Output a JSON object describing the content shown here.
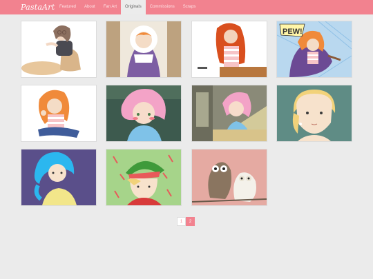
{
  "brand": "PastaArt",
  "nav": {
    "items": [
      {
        "label": "Featured"
      },
      {
        "label": "About"
      },
      {
        "label": "Fan Art"
      },
      {
        "label": "Originals",
        "active": true
      },
      {
        "label": "Commissions"
      },
      {
        "label": "Scraps"
      }
    ]
  },
  "gallery": {
    "thumbnails": [
      {
        "subject": "girl with glasses sitting"
      },
      {
        "subject": "girl in purple hooded cloak"
      },
      {
        "subject": "red-haired girl at table"
      },
      {
        "subject": "girl in cape, comic panel",
        "caption": "PEW!"
      },
      {
        "subject": "orange-haired girl sitting"
      },
      {
        "subject": "pink-haired girl blushing"
      },
      {
        "subject": "pink-haired girl by window"
      },
      {
        "subject": "blonde girl portrait"
      },
      {
        "subject": "blue-haired girl portrait"
      },
      {
        "subject": "elf with candy canes"
      },
      {
        "subject": "two owls"
      }
    ]
  },
  "pagination": {
    "pages": [
      "1",
      "2"
    ],
    "current": "2"
  },
  "colors": {
    "accent": "#f2828f",
    "background": "#ebebeb"
  }
}
